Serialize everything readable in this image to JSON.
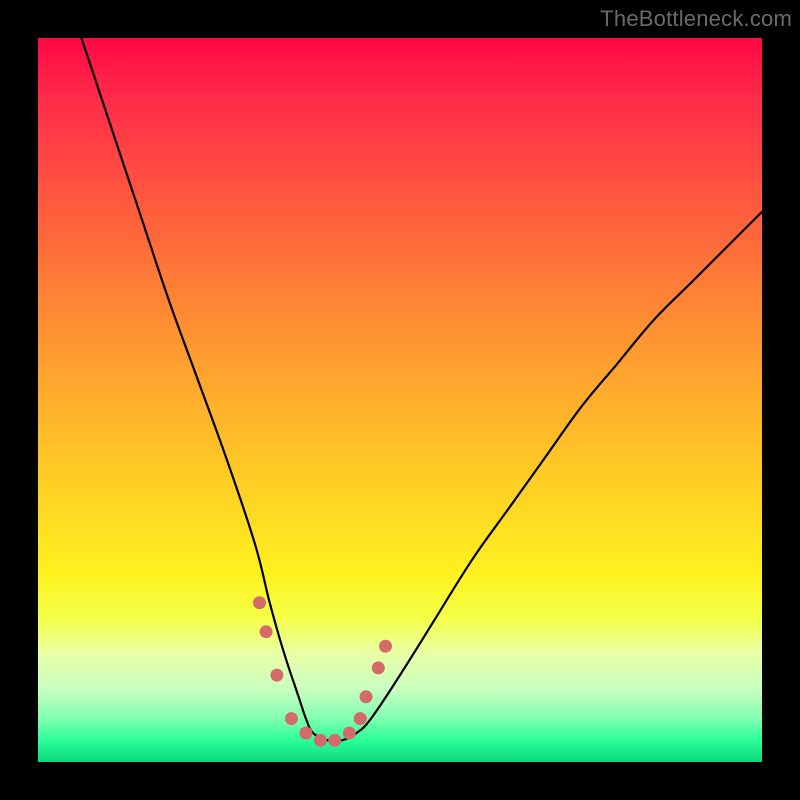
{
  "watermark": {
    "text": "TheBottleneck.com"
  },
  "chart_data": {
    "type": "line",
    "title": "",
    "xlabel": "",
    "ylabel": "",
    "xlim": [
      0,
      100
    ],
    "ylim": [
      0,
      100
    ],
    "grid": false,
    "series": [
      {
        "name": "bottleneck-curve",
        "x": [
          6,
          10,
          14,
          18,
          22,
          26,
          30,
          32,
          34,
          36,
          37,
          38,
          40,
          42,
          44,
          46,
          50,
          55,
          60,
          65,
          70,
          75,
          80,
          85,
          90,
          95,
          100
        ],
        "values": [
          100,
          88,
          76,
          64,
          53,
          42,
          30,
          22,
          15,
          9,
          6,
          4,
          3,
          3,
          4,
          6,
          12,
          20,
          28,
          35,
          42,
          49,
          55,
          61,
          66,
          71,
          76
        ]
      }
    ],
    "markers": [
      {
        "name": "marker-segment",
        "x": [
          30.6,
          31.5,
          33.0,
          35.0,
          37.0,
          39.0,
          41.0,
          43.0,
          44.5,
          45.3,
          47.0,
          48.0
        ],
        "values": [
          22,
          18,
          12,
          6,
          4,
          3,
          3,
          4,
          6,
          9,
          13,
          16
        ],
        "color": "#d46a6a",
        "size": 13
      }
    ],
    "background_gradient": {
      "top_color": "#ff0844",
      "mid_color": "#ffd024",
      "bottom_color": "#0cd87a"
    }
  }
}
